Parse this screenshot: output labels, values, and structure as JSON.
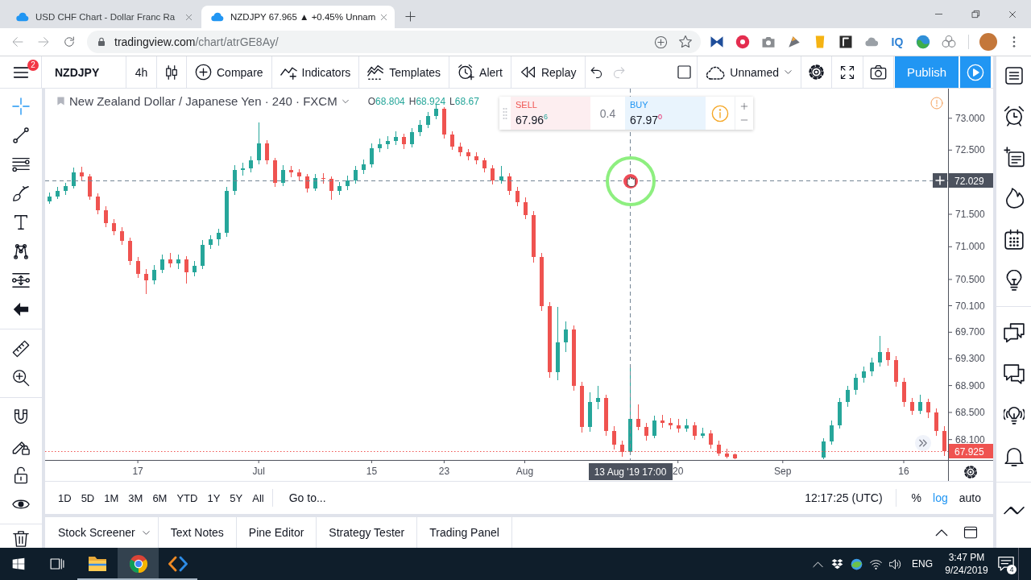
{
  "browser": {
    "tabs": [
      {
        "title": "USD CHF Chart - Dollar Franc Ra",
        "selected": false
      },
      {
        "title": "NZDJPY 67.965 ▲ +0.45% Unnam",
        "selected": true
      }
    ],
    "url": {
      "host": "tradingview.com",
      "path": "/chart/atrGE8Ay/"
    },
    "extension_text": "IQ"
  },
  "toolbar": {
    "menu_badge": "2",
    "symbol": "NZDJPY",
    "interval": "4h",
    "buttons": [
      {
        "kind": "compare",
        "label": "Compare"
      },
      {
        "kind": "indicators",
        "label": "Indicators"
      },
      {
        "kind": "templates",
        "label": "Templates"
      },
      {
        "kind": "alert",
        "label": "Alert"
      },
      {
        "kind": "replay",
        "label": "Replay"
      }
    ],
    "history": [
      {
        "kind": "undo",
        "disabled": false
      },
      {
        "kind": "redo",
        "disabled": true
      }
    ],
    "layout_name": "Unnamed",
    "publish": "Publish"
  },
  "drawing_tools": [
    [
      {
        "kind": "crosshair",
        "selected": true
      },
      {
        "kind": "trendline",
        "selected": false
      },
      {
        "kind": "lines",
        "selected": false
      },
      {
        "kind": "brush",
        "selected": false
      },
      {
        "kind": "text",
        "selected": false
      },
      {
        "kind": "pattern",
        "selected": false
      },
      {
        "kind": "measure",
        "selected": false
      },
      {
        "kind": "arrow",
        "selected": false
      }
    ],
    [
      {
        "kind": "ruler",
        "selected": false
      },
      {
        "kind": "zoom",
        "selected": false
      }
    ],
    [
      {
        "kind": "magnet",
        "selected": false
      },
      {
        "kind": "drawlock",
        "selected": false
      },
      {
        "kind": "lock",
        "selected": false
      },
      {
        "kind": "eye",
        "selected": false
      }
    ],
    [
      {
        "kind": "trash",
        "selected": false
      }
    ]
  ],
  "chart": {
    "title": "New Zealand Dollar / Japanese Yen · 240 · FXCM",
    "ohlc_legend": [
      {
        "label": "O",
        "value": "68.804"
      },
      {
        "label": "H",
        "value": "68.924"
      },
      {
        "label": "L",
        "value": "68.67"
      }
    ],
    "trade": {
      "sell_label": "SELL",
      "sell_price": "67.96$^{6}$",
      "spread": "0.4",
      "buy_label": "BUY",
      "buy_price": "67.97$^{0}$"
    },
    "crosshair_time": "13 Aug '19 17:00",
    "chart_data": [
      {
        "type": "candlestick",
        "log": true,
        "ylim": [
          67.8,
          73.47
        ],
        "yticks": [
          {
            "value": 73,
            "label": "73.000"
          },
          {
            "value": 72.5,
            "label": "72.500"
          },
          {
            "value": 71.5,
            "label": "71.500"
          },
          {
            "value": 71,
            "label": "71.000"
          },
          {
            "value": 70.5,
            "label": "70.500"
          },
          {
            "value": 70.1,
            "label": "70.100"
          },
          {
            "value": 69.7,
            "label": "69.700"
          },
          {
            "value": 69.3,
            "label": "69.300"
          },
          {
            "value": 68.9,
            "label": "68.900"
          },
          {
            "value": 68.5,
            "label": "68.500"
          },
          {
            "value": 68.1,
            "label": "68.100"
          }
        ],
        "categories": [
          null,
          null,
          null,
          null,
          null,
          null,
          null,
          null,
          null,
          null,
          null,
          "17",
          null,
          null,
          null,
          null,
          null,
          null,
          null,
          null,
          null,
          null,
          null,
          null,
          null,
          null,
          "Jul",
          null,
          null,
          null,
          null,
          null,
          null,
          null,
          null,
          null,
          null,
          null,
          null,
          null,
          "15",
          null,
          null,
          null,
          null,
          null,
          null,
          null,
          null,
          "23",
          null,
          null,
          null,
          null,
          null,
          null,
          null,
          null,
          null,
          "Aug",
          null,
          null,
          null,
          null,
          null,
          null,
          null,
          null,
          null,
          null,
          null,
          null,
          null,
          null,
          null,
          null,
          null,
          null,
          "20",
          null,
          null,
          null,
          null,
          null,
          null,
          null,
          null,
          null,
          null,
          null,
          null,
          "Sep",
          null,
          null,
          null,
          null,
          null,
          null,
          null,
          null,
          null,
          null,
          null,
          null,
          null,
          null,
          "16",
          null,
          null,
          null,
          null,
          null
        ],
        "ohlc": [
          [
            71.7,
            71.84,
            71.66,
            71.78
          ],
          [
            71.78,
            71.92,
            71.74,
            71.86
          ],
          [
            71.86,
            71.99,
            71.8,
            71.94
          ],
          [
            71.94,
            72.22,
            71.9,
            72.15
          ],
          [
            72.15,
            72.24,
            72.03,
            72.09
          ],
          [
            72.09,
            72.12,
            71.72,
            71.78
          ],
          [
            71.78,
            71.83,
            71.5,
            71.56
          ],
          [
            71.56,
            71.62,
            71.3,
            71.36
          ],
          [
            71.36,
            71.42,
            71.18,
            71.24
          ],
          [
            71.24,
            71.3,
            71.03,
            71.09
          ],
          [
            71.09,
            71.14,
            70.72,
            70.78
          ],
          [
            70.78,
            70.84,
            70.52,
            70.59
          ],
          [
            70.59,
            70.66,
            70.28,
            70.49
          ],
          [
            70.49,
            70.72,
            70.42,
            70.65
          ],
          [
            70.65,
            70.88,
            70.6,
            70.81
          ],
          [
            70.81,
            70.9,
            70.68,
            70.74
          ],
          [
            70.74,
            70.88,
            70.66,
            70.81
          ],
          [
            70.81,
            70.86,
            70.44,
            70.61
          ],
          [
            70.61,
            70.78,
            70.55,
            70.71
          ],
          [
            70.71,
            71.1,
            70.66,
            71.03
          ],
          [
            71.03,
            71.18,
            70.97,
            71.11
          ],
          [
            71.11,
            71.28,
            71.02,
            71.21
          ],
          [
            71.21,
            71.93,
            71.15,
            71.86
          ],
          [
            71.86,
            72.26,
            71.8,
            72.19
          ],
          [
            72.19,
            72.3,
            72.1,
            72.21
          ],
          [
            72.21,
            72.4,
            72.15,
            72.34
          ],
          [
            72.34,
            72.94,
            72.28,
            72.61
          ],
          [
            72.61,
            72.66,
            72.28,
            72.34
          ],
          [
            72.34,
            72.38,
            71.92,
            71.99
          ],
          [
            71.99,
            72.26,
            71.94,
            72.19
          ],
          [
            72.19,
            72.25,
            72.08,
            72.15
          ],
          [
            72.15,
            72.2,
            72.02,
            72.09
          ],
          [
            72.09,
            72.13,
            71.84,
            71.9
          ],
          [
            71.9,
            72.12,
            71.86,
            72.06
          ],
          [
            72.06,
            72.14,
            71.98,
            72.05
          ],
          [
            72.05,
            72.09,
            71.72,
            71.86
          ],
          [
            71.86,
            72.0,
            71.8,
            71.94
          ],
          [
            71.94,
            72.1,
            71.88,
            72.03
          ],
          [
            72.03,
            72.25,
            71.98,
            72.19
          ],
          [
            72.19,
            72.35,
            72.12,
            72.28
          ],
          [
            72.28,
            72.6,
            72.22,
            72.53
          ],
          [
            72.53,
            72.68,
            72.46,
            72.59
          ],
          [
            72.59,
            72.72,
            72.52,
            72.64
          ],
          [
            72.64,
            72.8,
            72.58,
            72.71
          ],
          [
            72.71,
            72.76,
            72.52,
            72.59
          ],
          [
            72.59,
            72.85,
            72.54,
            72.78
          ],
          [
            72.78,
            72.97,
            72.72,
            72.9
          ],
          [
            72.9,
            73.1,
            72.84,
            73.03
          ],
          [
            73.03,
            73.22,
            72.98,
            73.15
          ],
          [
            73.15,
            73.18,
            72.68,
            72.74
          ],
          [
            72.74,
            72.8,
            72.5,
            72.56
          ],
          [
            72.56,
            72.62,
            72.4,
            72.46
          ],
          [
            72.46,
            72.52,
            72.34,
            72.4
          ],
          [
            72.4,
            72.47,
            72.28,
            72.34
          ],
          [
            72.34,
            72.38,
            72.15,
            72.21
          ],
          [
            72.21,
            72.26,
            71.96,
            72.03
          ],
          [
            72.03,
            72.25,
            71.98,
            72.09
          ],
          [
            72.09,
            72.14,
            71.8,
            71.86
          ],
          [
            71.86,
            71.93,
            71.62,
            71.69
          ],
          [
            71.69,
            71.76,
            71.42,
            71.49
          ],
          [
            71.49,
            71.55,
            70.76,
            70.84
          ],
          [
            70.84,
            70.9,
            70.02,
            70.1
          ],
          [
            70.1,
            70.16,
            69.02,
            69.1
          ],
          [
            69.1,
            70.08,
            68.98,
            69.55
          ],
          [
            69.55,
            69.86,
            69.4,
            69.74
          ],
          [
            69.74,
            69.8,
            68.82,
            68.89
          ],
          [
            68.89,
            68.95,
            68.2,
            68.29
          ],
          [
            68.29,
            68.8,
            68.22,
            68.65
          ],
          [
            68.65,
            68.9,
            68.55,
            68.71
          ],
          [
            68.71,
            68.76,
            68.16,
            68.23
          ],
          [
            68.23,
            68.3,
            67.95,
            68.02
          ],
          [
            68.02,
            68.08,
            67.85,
            67.92
          ],
          [
            67.92,
            69.16,
            67.88,
            68.41
          ],
          [
            68.41,
            68.62,
            68.24,
            68.29
          ],
          [
            68.29,
            68.35,
            68.08,
            68.16
          ],
          [
            68.16,
            68.45,
            68.12,
            68.38
          ],
          [
            68.38,
            68.47,
            68.28,
            68.35
          ],
          [
            68.35,
            68.42,
            68.25,
            68.31
          ],
          [
            68.31,
            68.4,
            68.2,
            68.26
          ],
          [
            68.26,
            68.4,
            68.22,
            68.31
          ],
          [
            68.31,
            68.36,
            68.1,
            68.16
          ],
          [
            68.16,
            68.28,
            68.12,
            68.19
          ],
          [
            68.19,
            68.24,
            67.96,
            68.02
          ],
          [
            68.02,
            68.08,
            67.86,
            67.9
          ],
          [
            67.9,
            67.97,
            67.82,
            67.85
          ],
          [
            67.88,
            67.89,
            67.81,
            67.82
          ],
          null,
          null,
          null,
          null,
          null,
          null,
          null,
          null,
          null,
          null,
          [
            67.83,
            68.12,
            67.81,
            68.07
          ],
          [
            68.07,
            68.38,
            68.02,
            68.31
          ],
          [
            68.31,
            68.72,
            68.26,
            68.65
          ],
          [
            68.65,
            68.9,
            68.58,
            68.83
          ],
          [
            68.83,
            69.08,
            68.76,
            69.01
          ],
          [
            69.01,
            69.18,
            68.94,
            69.11
          ],
          [
            69.11,
            69.32,
            69.04,
            69.25
          ],
          [
            69.25,
            69.64,
            69.18,
            69.4
          ],
          [
            69.4,
            69.46,
            69.2,
            69.28
          ],
          [
            69.28,
            69.34,
            68.88,
            68.95
          ],
          [
            68.95,
            69.02,
            68.58,
            68.65
          ],
          [
            68.65,
            68.72,
            68.46,
            68.53
          ],
          [
            68.53,
            68.76,
            68.48,
            68.65
          ],
          [
            68.65,
            68.7,
            68.42,
            68.5
          ],
          [
            68.5,
            68.56,
            68.16,
            68.23
          ],
          [
            68.23,
            68.3,
            67.86,
            67.925
          ]
        ],
        "ref_lines": [
          {
            "axis": "y",
            "value": 72.029,
            "label": "72.029",
            "line_style": "dashed"
          },
          {
            "axis": "y",
            "value": 67.925,
            "label": "67.925",
            "color": "#ef5350",
            "line_style": "dotted"
          }
        ]
      }
    ]
  },
  "range_bar": {
    "ranges": [
      "1D",
      "5D",
      "1M",
      "3M",
      "6M",
      "YTD",
      "1Y",
      "5Y",
      "All"
    ],
    "goto": "Go to...",
    "clock": "12:17:25 (UTC)",
    "scale_options": [
      {
        "label": "%",
        "on": false
      },
      {
        "label": "log",
        "on": true
      },
      {
        "label": "auto",
        "on": false
      }
    ]
  },
  "bottom_panel": {
    "tabs": [
      {
        "label": "Stock Screener",
        "dropdown": true
      },
      {
        "label": "Text Notes",
        "dropdown": false
      },
      {
        "label": "Pine Editor",
        "dropdown": false
      },
      {
        "label": "Strategy Tester",
        "dropdown": false
      },
      {
        "label": "Trading Panel",
        "dropdown": false
      }
    ]
  },
  "taskbar": {
    "apps": [
      {
        "kind": "explorer",
        "active": false
      },
      {
        "kind": "browser",
        "active": true
      },
      {
        "kind": "code",
        "active": false
      }
    ],
    "language": "ENG",
    "time": "3:47 PM",
    "date": "9/24/2019",
    "notifications": "4"
  }
}
